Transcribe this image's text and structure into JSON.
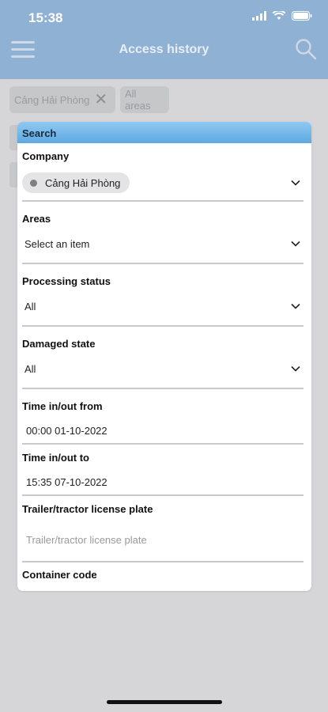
{
  "status": {
    "time": "15:38"
  },
  "header": {
    "title": "Access history"
  },
  "chips": {
    "company": "Cảng Hải Phòng",
    "areas": "All areas"
  },
  "panel": {
    "title": "Search",
    "company": {
      "label": "Company",
      "value": "Cảng Hải Phòng"
    },
    "areas": {
      "label": "Areas",
      "value": "Select an item"
    },
    "processing_status": {
      "label": "Processing status",
      "value": "All"
    },
    "damaged_state": {
      "label": "Damaged state",
      "value": "All"
    },
    "time_from": {
      "label": "Time in/out from",
      "value": "00:00 01-10-2022"
    },
    "time_to": {
      "label": "Time in/out to",
      "value": "15:35 07-10-2022"
    },
    "plate": {
      "label": "Trailer/tractor license plate",
      "placeholder": "Trailer/tractor license plate"
    },
    "container": {
      "label": "Container code"
    }
  },
  "colors": {
    "header": "#8fb1d3",
    "panel_header": "#5ea9e2",
    "background": "#d6d6d8"
  }
}
